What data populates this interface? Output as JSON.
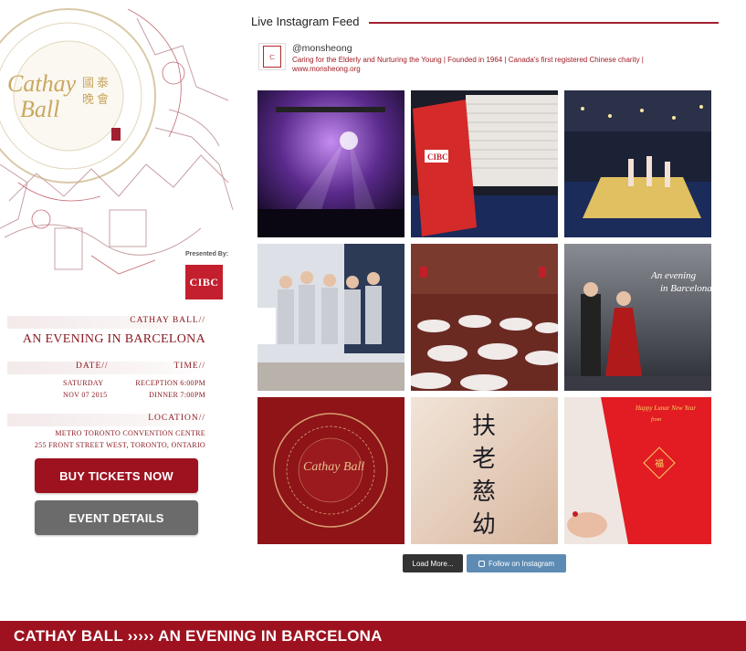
{
  "sidebar": {
    "presented_by": "Presented By:",
    "sponsor_logo": "CIBC",
    "event_label": "CATHAY BALL//",
    "event_title": "AN EVENING IN BARCELONA",
    "date_label": "DATE//",
    "time_label": "TIME//",
    "date_day": "SATURDAY",
    "date_full": "NOV 07 2015",
    "time_reception": "RECEPTION 6:00PM",
    "time_dinner": "DINNER 7:00PM",
    "location_label": "LOCATION//",
    "location_venue": "METRO TORONTO CONVENTION CENTRE",
    "location_address": "255 FRONT STREET WEST, TORONTO, ONTARIO",
    "buy_tickets": "BUY TICKETS NOW",
    "event_details": "EVENT DETAILS"
  },
  "feed": {
    "heading": "Live Instagram Feed",
    "username": "@monsheong",
    "bio": "Caring for the Elderly and Nurturing the Young | Founded in 1964 | Canada's first registered Chinese charity | www.monsheong.org",
    "photos": [
      {
        "icon": "concert-stage-photo"
      },
      {
        "icon": "cibc-bag-photo"
      },
      {
        "icon": "ballroom-runway-photo"
      },
      {
        "icon": "staff-group-photo"
      },
      {
        "icon": "banquet-hall-photo"
      },
      {
        "icon": "barcelona-dancers-photo"
      },
      {
        "icon": "cathay-ball-plate-photo",
        "text": "Cathay Ball"
      },
      {
        "icon": "calligraphy-photo",
        "text": "扶老慈幼"
      },
      {
        "icon": "red-envelope-photo",
        "text": "Happy Lunar New Year"
      }
    ],
    "load_more": "Load More...",
    "follow": "Follow on Instagram"
  },
  "footer": {
    "banner": "CATHAY BALL ›››››  AN EVENING IN BARCELONA"
  },
  "colors": {
    "accent": "#9e1220",
    "button_gray": "#6b6b6b",
    "follow_blue": "#5d8bb3"
  }
}
